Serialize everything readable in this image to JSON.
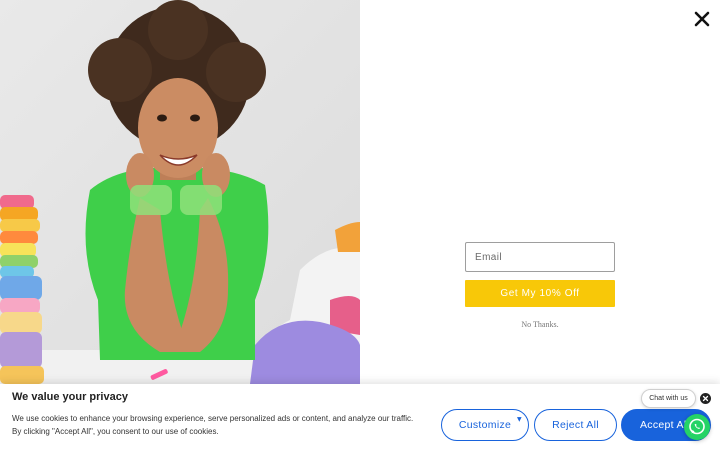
{
  "popup": {
    "email_placeholder": "Email",
    "cta_label": "Get My 10% Off",
    "decline_label": "No Thanks.",
    "close_icon": "close-icon",
    "accent_color": "#f8c808"
  },
  "cookie_banner": {
    "title": "We value your privacy",
    "body": "We use cookies to enhance your browsing experience, serve personalized ads or content, and analyze our traffic. By clicking \"Accept All\", you consent to our use of cookies.",
    "customize_label": "Customize",
    "reject_label": "Reject All",
    "accept_label": "Accept All",
    "accent_color": "#1863dc"
  },
  "chat_widget": {
    "label": "Chat with us",
    "icon": "whatsapp-icon",
    "color": "#25d366"
  }
}
